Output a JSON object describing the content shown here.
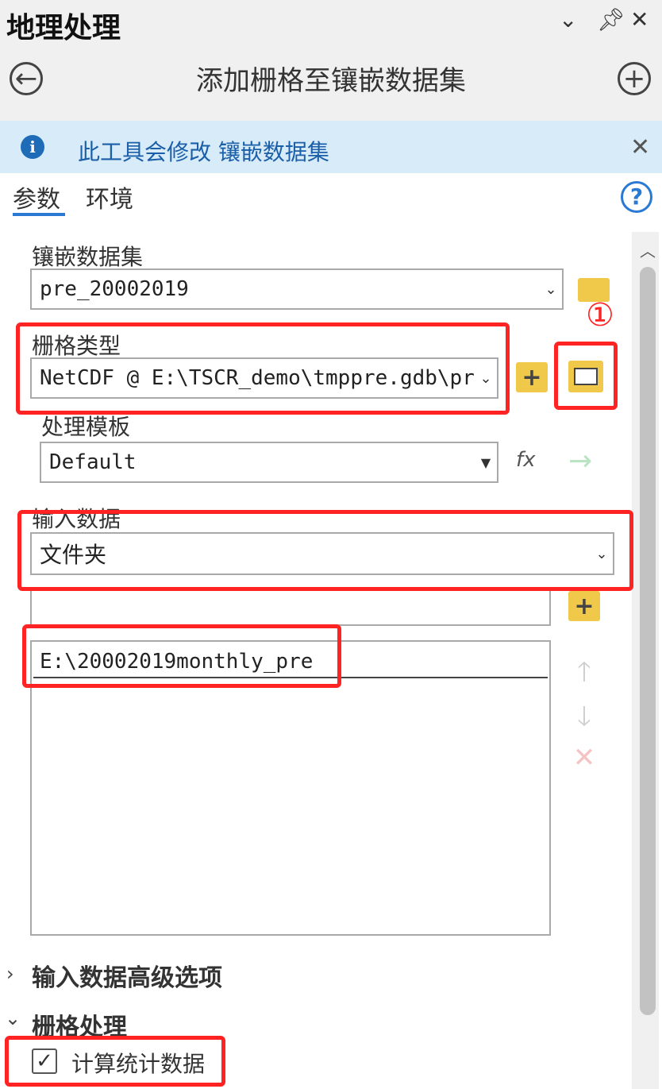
{
  "pane": {
    "title": "地理处理",
    "controls": {
      "menu_icon": "chevron-down-icon",
      "pin_icon": "pin-icon",
      "close_icon": "close-icon"
    }
  },
  "tool": {
    "title": "添加栅格至镶嵌数据集",
    "back_icon": "back-arrow-icon",
    "add_icon": "plus-circle-icon"
  },
  "info_bar": {
    "text": "此工具会修改 镶嵌数据集",
    "icon": "info-icon",
    "close_icon": "close-icon"
  },
  "tabs": [
    {
      "label": "参数",
      "active": true
    },
    {
      "label": "环境",
      "active": false
    }
  ],
  "help_icon": "help-icon",
  "params": {
    "mosaic_dataset": {
      "label": "镶嵌数据集",
      "value": "pre_20002019"
    },
    "raster_type": {
      "label": "栅格类型",
      "value": "NetCDF @ E:\\TSCR_demo\\tmppre.gdb\\pre_"
    },
    "processing_template": {
      "label": "处理模板",
      "value": "Default"
    },
    "input_data": {
      "label": "输入数据",
      "value": "文件夹"
    },
    "input_list": {
      "items": [
        "E:\\20002019monthly_pre"
      ]
    }
  },
  "annotation": {
    "marker": "①"
  },
  "sections": [
    {
      "label": "输入数据高级选项",
      "expanded": false
    },
    {
      "label": "栅格处理",
      "expanded": true
    }
  ],
  "options": {
    "compute_statistics": {
      "label": "计算统计数据",
      "checked": true
    }
  },
  "colors": {
    "accent": "#2a7ad3",
    "highlight": "#ff2323",
    "info_bg": "#d8ebf8",
    "folder": "#f0c94a"
  }
}
